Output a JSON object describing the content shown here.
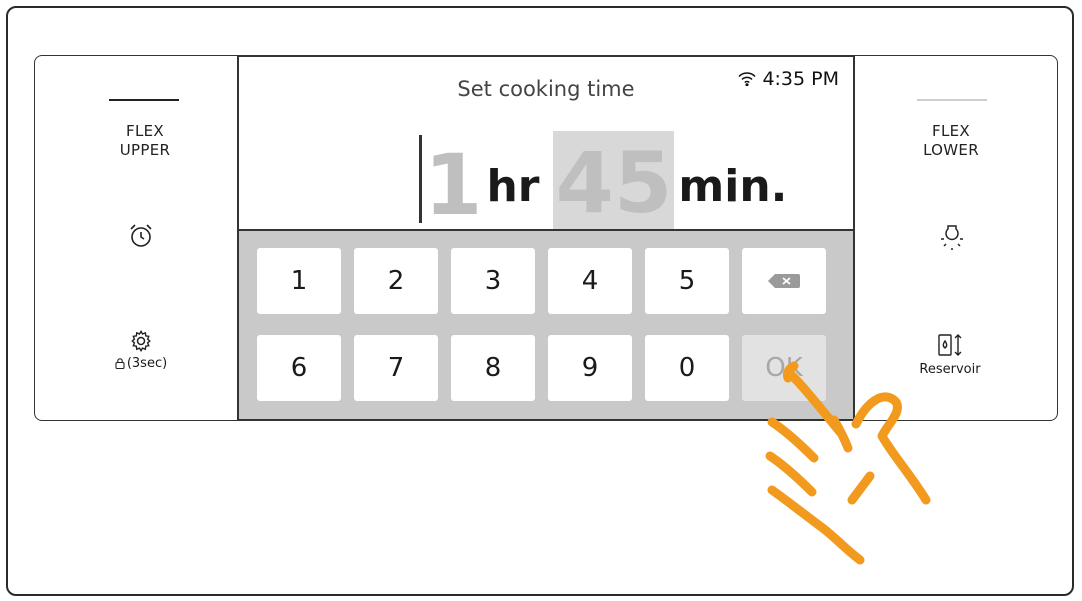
{
  "left_panel": {
    "mode_label_line1": "FLEX",
    "mode_label_line2": "UPPER",
    "alarm_icon": "alarm-clock-icon",
    "settings_icon": "gear-icon",
    "lock_label": "(3sec)"
  },
  "right_panel": {
    "mode_label_line1": "FLEX",
    "mode_label_line2": "LOWER",
    "light_icon": "light-bulb-icon",
    "reservoir_label": "Reservoir"
  },
  "screen": {
    "title": "Set cooking time",
    "clock": "4:35 PM",
    "hours_value": "1",
    "hours_unit": "hr",
    "minutes_value": "45",
    "minutes_unit": "min."
  },
  "keypad": {
    "row1": [
      "1",
      "2",
      "3",
      "4",
      "5"
    ],
    "row2": [
      "6",
      "7",
      "8",
      "9",
      "0"
    ],
    "ok_label": "OK"
  },
  "colors": {
    "hand": "#f29a1e",
    "keypad_bg": "#c9c9c9",
    "dim_digit": "#bfbfbf"
  }
}
